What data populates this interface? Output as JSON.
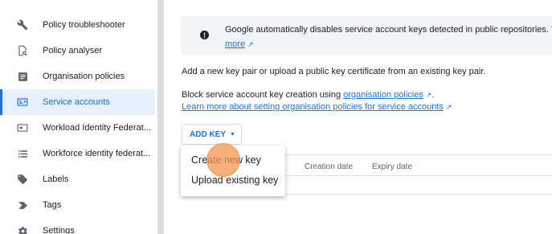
{
  "sidebar": {
    "items": [
      {
        "label": "Policy troubleshooter",
        "icon": "wrench-icon",
        "active": false
      },
      {
        "label": "Policy analyser",
        "icon": "document-search-icon",
        "active": false
      },
      {
        "label": "Organisation policies",
        "icon": "policy-list-icon",
        "active": false
      },
      {
        "label": "Service accounts",
        "icon": "service-account-icon",
        "active": true
      },
      {
        "label": "Workload Identity Federat...",
        "icon": "id-card-icon",
        "active": false
      },
      {
        "label": "Workforce identity federat...",
        "icon": "list-icon",
        "active": false
      },
      {
        "label": "Labels",
        "icon": "tag-icon",
        "active": false
      },
      {
        "label": "Tags",
        "icon": "chevron-tag-icon",
        "active": false
      },
      {
        "label": "Settings",
        "icon": "gear-icon",
        "active": false
      }
    ]
  },
  "banner": {
    "text": "Google automatically disables service account keys detected in public repositories. You c",
    "more_link": "more"
  },
  "intro_text": "Add a new key pair or upload a public key certificate from an existing key pair.",
  "block_text_prefix": "Block service account key creation using ",
  "block_link": "organisation policies",
  "block_text_suffix": ".",
  "learn_more_link": "Learn more about setting organisation policies for service accounts",
  "add_key_label": "ADD KEY",
  "table": {
    "headers": [
      "Creation date",
      "Expiry date"
    ]
  },
  "menu": {
    "items": [
      "Create new key",
      "Upload existing key"
    ]
  },
  "colors": {
    "accent": "#1a73e8",
    "active_bg": "#e8f0fe",
    "pointer": "#f49550"
  }
}
